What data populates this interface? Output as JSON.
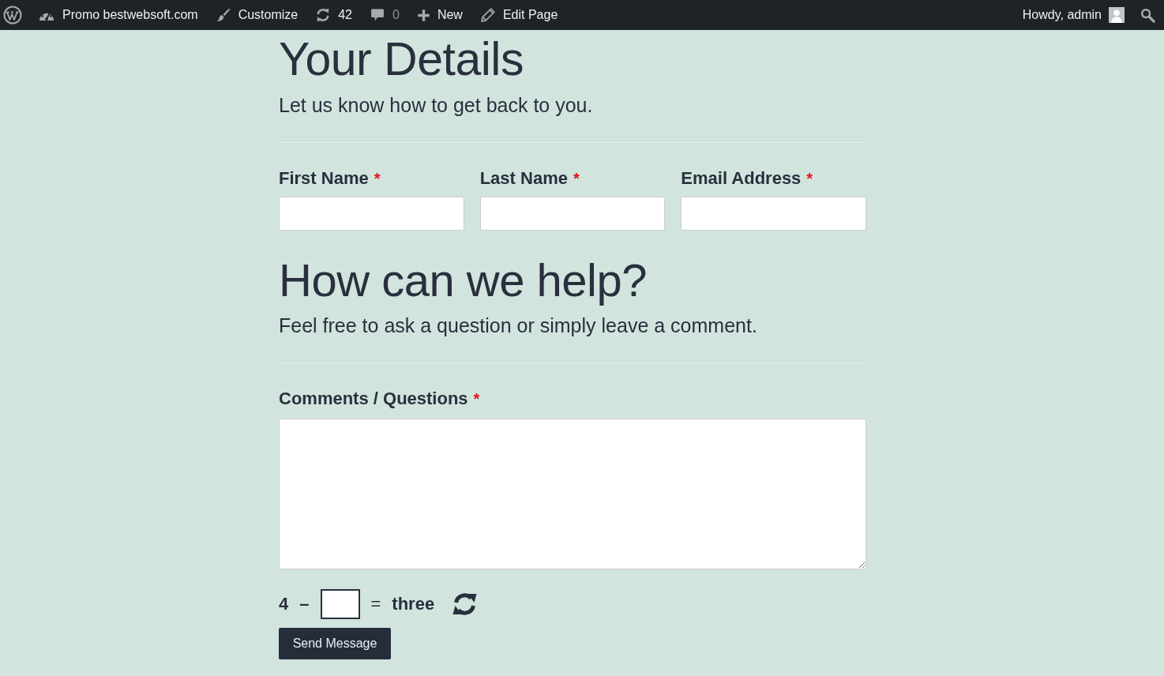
{
  "admin_bar": {
    "items": [
      {
        "kind": "site",
        "label": "Promo bestwebsoft.com",
        "muted": false
      },
      {
        "kind": "customize",
        "label": "Customize",
        "muted": false
      },
      {
        "kind": "updates",
        "label": "42",
        "muted": false
      },
      {
        "kind": "comments",
        "label": "0",
        "muted": true
      },
      {
        "kind": "new",
        "label": "New",
        "muted": false
      },
      {
        "kind": "edit",
        "label": "Edit Page",
        "muted": false
      }
    ],
    "account": {
      "label": "Howdy, admin"
    }
  },
  "sections": [
    {
      "title": "Your Details",
      "subtitle": "Let us know how to get back to you.",
      "fields": [
        {
          "kind": "input",
          "label": "First Name",
          "required_mark": "*"
        },
        {
          "kind": "input",
          "label": "Last Name",
          "required_mark": "*"
        },
        {
          "kind": "input",
          "label": "Email Address",
          "required_mark": "*"
        }
      ]
    },
    {
      "title": "How can we help?",
      "subtitle": "Feel free to ask a question or simply leave a comment.",
      "fields": [
        {
          "kind": "textarea",
          "label": "Comments / Questions",
          "required_mark": "*"
        }
      ]
    }
  ],
  "captcha": {
    "operand": "4",
    "operator": "–",
    "equals": "=",
    "result": "three"
  },
  "submit_button": {
    "label": "Send Message"
  }
}
